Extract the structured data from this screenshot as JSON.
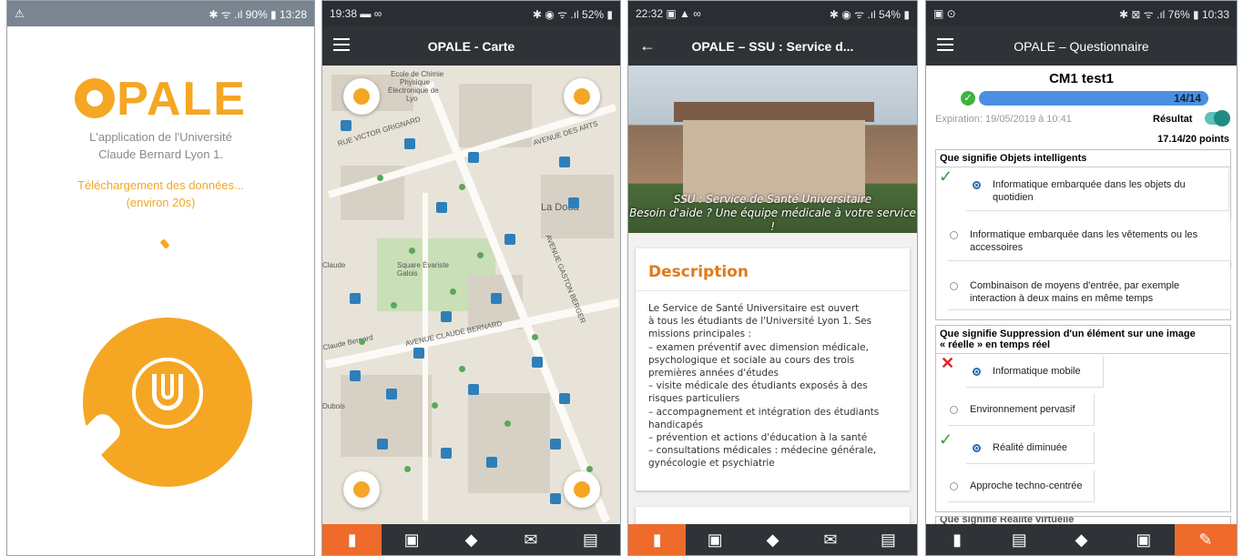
{
  "phone1": {
    "status": {
      "left": "⚠",
      "right": "✱ ᯤ .ıl 90% ▮ 13:28"
    },
    "logo_rest": "PALE",
    "subtitle_l1": "L'application de l'Université",
    "subtitle_l2": "Claude Bernard Lyon 1.",
    "loading_l1": "Téléchargement des données...",
    "loading_l2": "(environ 20s)"
  },
  "phone2": {
    "status": {
      "left": "19:38 ▬ ∞",
      "right": "✱ ◉ ᯤ .ıl 52% ▮"
    },
    "title": "OPALE - Carte",
    "map_labels": {
      "chimie": "Ecole de Chimie",
      "physique": "Physique",
      "electronique": "Électronique de",
      "lyon": "Lyo",
      "victor": "RUE VICTOR GRIGNARD",
      "arts": "AVENUE DES ARTS",
      "berger": "AVENUE GASTON BERGER",
      "doua": "La Doua",
      "galois": "Square Évariste Galois",
      "claude": "Claude",
      "bernard": "AVENUE CLAUDE BERNARD",
      "stl": "Claude Bernard",
      "dubois": "Dubois"
    },
    "nav": [
      "map-icon",
      "calendar-icon",
      "school-icon",
      "mail-icon",
      "book-icon"
    ]
  },
  "phone3": {
    "status": {
      "left": "22:32 ▣ ▲ ∞",
      "right": "✱ ◉ ᯤ .ıl 54% ▮"
    },
    "back": "←",
    "title": "OPALE – SSU : Service d...",
    "caption_l1": "SSU : Service de Santé Universitaire",
    "caption_l2": "Besoin d'aide ? Une équipe médicale à votre service !",
    "desc_title": "Description",
    "desc_text": "Le Service de Santé Universitaire est ouvert\nà tous les étudiants de l'Université Lyon 1. Ses\nmissions principales :\n– examen préventif avec dimension médicale,\npsychologique et sociale au cours des trois\npremières années d'études\n– visite médicale des étudiants exposés à des\nrisques particuliers\n– accompagnement et intégration des étudiants\nhandicapés\n– prévention et actions d'éducation à la santé\n– consultations médicales : médecine générale,\ngynécologie et psychiatrie"
  },
  "phone4": {
    "status": {
      "left": "▣ ⊙",
      "right": "✱ ⊠ ᯤ .ıl 76% ▮ 10:33"
    },
    "title": "OPALE – Questionnaire",
    "quiz_name": "CM1 test1",
    "progress_label": "14/14",
    "progress": 1.0,
    "expiration": "Expiration: 19/05/2019 à 10:41",
    "result_label": "Résultat",
    "score": "17.14/20 points",
    "q1": {
      "title": "Que signifie Objets intelligents",
      "opt1": "Informatique embarquée dans les objets du quotidien",
      "opt2": "Informatique embarquée dans les vêtements ou les accessoires",
      "opt3": "Combinaison de moyens d'entrée, par exemple interaction à deux mains en même temps"
    },
    "q2": {
      "title_l1": "Que signifie Suppression d'un élément sur une image",
      "title_l2": "« réelle » en temps réel",
      "opt1": "Informatique mobile",
      "opt2": "Environnement pervasif",
      "opt3": "Réalité diminuée",
      "opt4": "Approche techno-centrée"
    },
    "q3_partial": "Que signifie Réalité virtuelle"
  }
}
